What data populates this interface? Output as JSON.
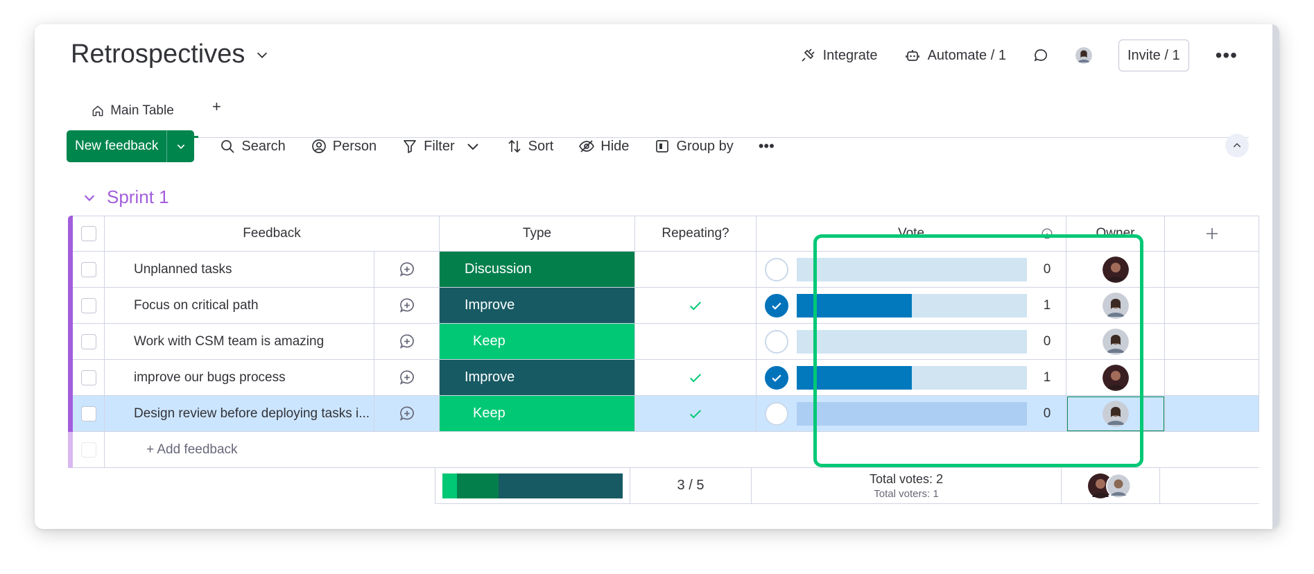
{
  "board": {
    "title": "Retrospectives"
  },
  "header": {
    "integrate": "Integrate",
    "automate": "Automate / 1",
    "invite": "Invite / 1"
  },
  "tabs": {
    "main": "Main Table",
    "add": "+"
  },
  "toolbar": {
    "new_item": "New feedback",
    "search": "Search",
    "person": "Person",
    "filter": "Filter",
    "sort": "Sort",
    "hide": "Hide",
    "group_by": "Group by"
  },
  "group": {
    "title": "Sprint 1",
    "color": "#a25ddc"
  },
  "columns": {
    "feedback": "Feedback",
    "type": "Type",
    "repeating": "Repeating?",
    "vote": "Vote",
    "owner": "Owner"
  },
  "rows": [
    {
      "name": "Unplanned tasks",
      "type": "Discussion",
      "type_color": "#037f4c",
      "repeating": false,
      "voted": false,
      "votes": 0,
      "vote_fill": 0.0,
      "owner": "dark-avatar"
    },
    {
      "name": "Focus on critical path",
      "type": "Improve",
      "type_color": "#175a63",
      "repeating": true,
      "voted": true,
      "votes": 1,
      "vote_fill": 0.5,
      "owner": "light-avatar"
    },
    {
      "name": "Work with CSM team is amazing",
      "type": "Keep",
      "type_color": "#00c875",
      "repeating": false,
      "voted": false,
      "votes": 0,
      "vote_fill": 0.0,
      "owner": "light-avatar"
    },
    {
      "name": "improve our bugs process",
      "type": "Improve",
      "type_color": "#175a63",
      "repeating": true,
      "voted": true,
      "votes": 1,
      "vote_fill": 0.5,
      "owner": "dark-avatar"
    },
    {
      "name": "Design review before deploying tasks i...",
      "type": "Keep",
      "type_color": "#00c875",
      "repeating": true,
      "voted": false,
      "votes": 0,
      "vote_fill": 0.0,
      "owner": "light-avatar",
      "selected": true
    }
  ],
  "add_row": "+ Add feedback",
  "footer": {
    "repeating_summary": "3 / 5",
    "total_votes": "Total votes: 2",
    "total_voters": "Total voters: 1",
    "type_distribution": [
      {
        "color": "#00c875",
        "fraction": 0.08
      },
      {
        "color": "#037f4c",
        "fraction": 0.23
      },
      {
        "color": "#175a63",
        "fraction": 0.69
      }
    ]
  },
  "colors": {
    "accent": "#00854d",
    "vote_blue": "#0073bb",
    "highlight": "#00c875"
  }
}
